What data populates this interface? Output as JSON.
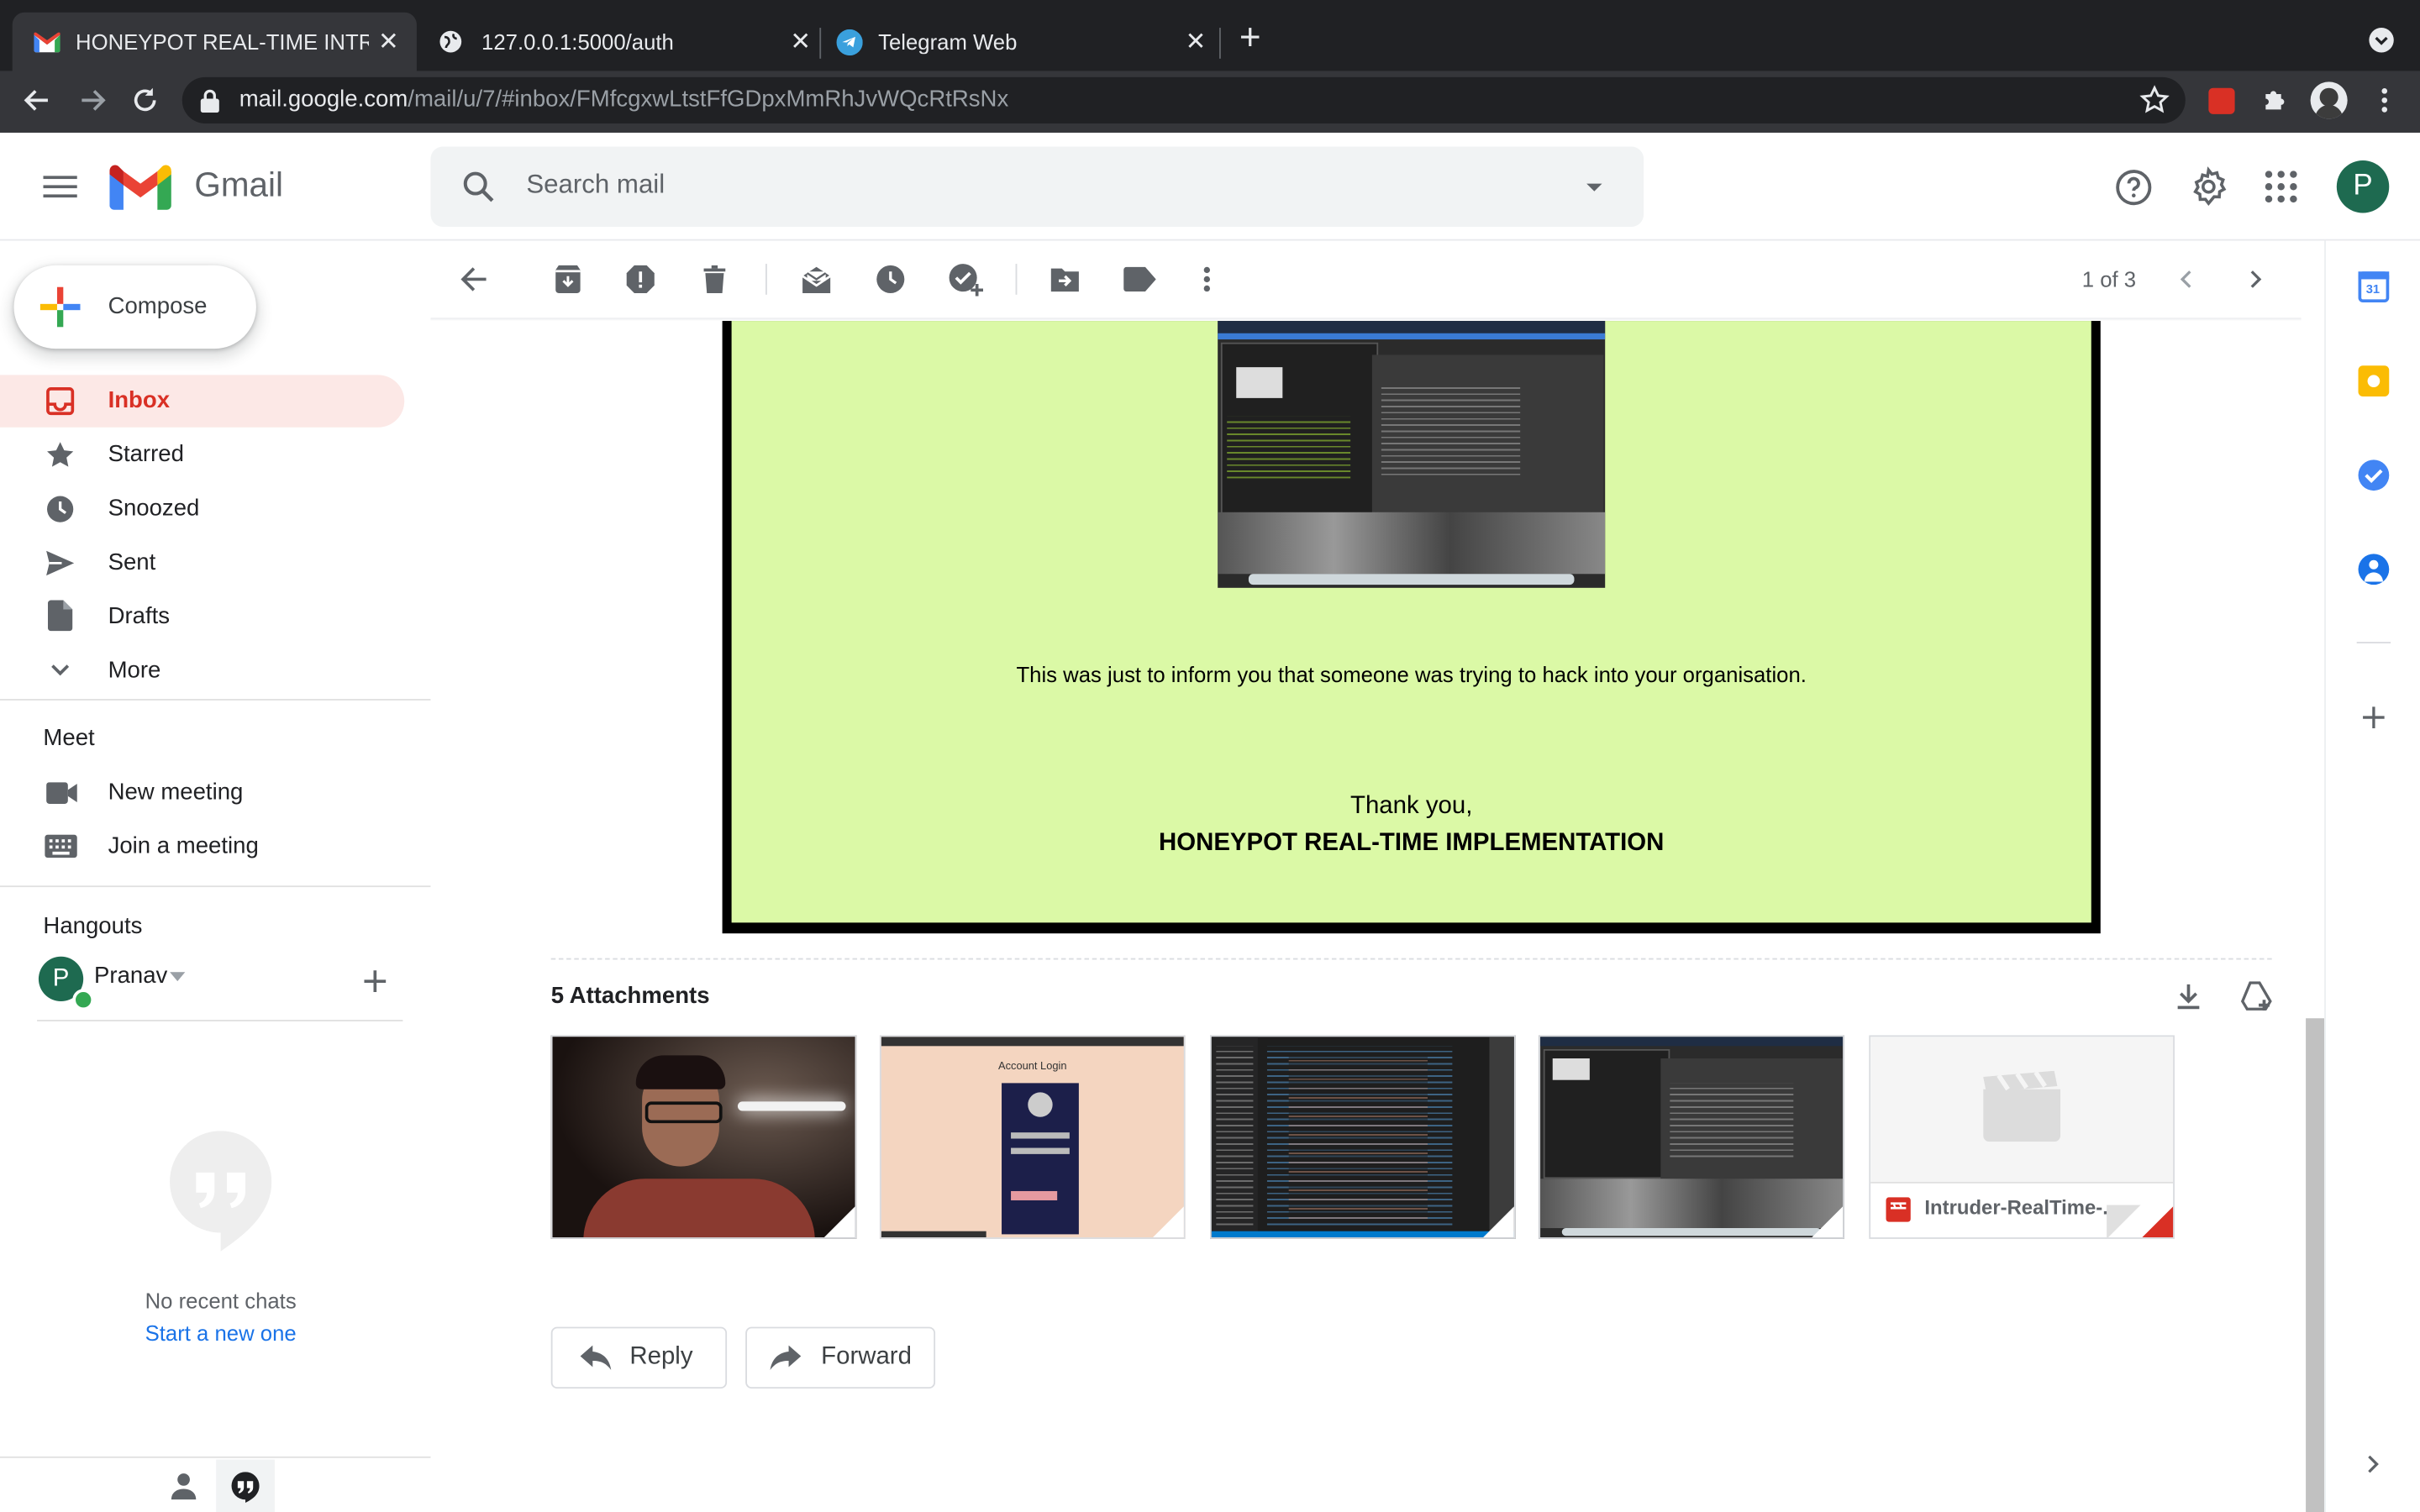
{
  "browser": {
    "tabs": [
      {
        "title": "HONEYPOT REAL-TIME INTRU",
        "active": true
      },
      {
        "title": "127.0.0.1:5000/auth",
        "active": false
      },
      {
        "title": "Telegram Web",
        "active": false
      }
    ],
    "url_host": "mail.google.com",
    "url_path": "/mail/u/7/#inbox/FMfcgxwLtstFfGDpxMmRhJvWQcRtRsNx",
    "profile_initial": "P"
  },
  "gmail": {
    "brand": "Gmail",
    "search_placeholder": "Search mail",
    "account_initial": "P"
  },
  "sidebar": {
    "compose": "Compose",
    "items": [
      {
        "label": "Inbox",
        "icon": "inbox-icon",
        "active": true
      },
      {
        "label": "Starred",
        "icon": "star-icon",
        "active": false
      },
      {
        "label": "Snoozed",
        "icon": "clock-icon",
        "active": false
      },
      {
        "label": "Sent",
        "icon": "send-icon",
        "active": false
      },
      {
        "label": "Drafts",
        "icon": "draft-icon",
        "active": false
      },
      {
        "label": "More",
        "icon": "chevron-down-icon",
        "active": false
      }
    ],
    "meet": {
      "title": "Meet",
      "new_meeting": "New meeting",
      "join_meeting": "Join a meeting"
    },
    "hangouts": {
      "title": "Hangouts",
      "user": "Pranav",
      "user_initial": "P",
      "no_chats": "No recent chats",
      "start_new": "Start a new one"
    }
  },
  "toolbar": {
    "pager": "1 of 3"
  },
  "email": {
    "message": "This was just to inform you that someone was trying to hack into your organisation.",
    "thanks": "Thank you,",
    "signature": "HONEYPOT REAL-TIME IMPLEMENTATION",
    "attachments_title": "5 Attachments",
    "attachments": [
      {
        "kind": "webcam-photo"
      },
      {
        "kind": "login-page",
        "caption": "Account Login"
      },
      {
        "kind": "code-editor"
      },
      {
        "kind": "desktop-screenshot"
      },
      {
        "kind": "video",
        "name": "Intruder-RealTime-..."
      }
    ],
    "reply": "Reply",
    "forward": "Forward"
  },
  "colors": {
    "email_background": "#dbf9a6",
    "gmail_red": "#d93025",
    "active_nav": "#fce8e6",
    "link_blue": "#1a73e8"
  }
}
